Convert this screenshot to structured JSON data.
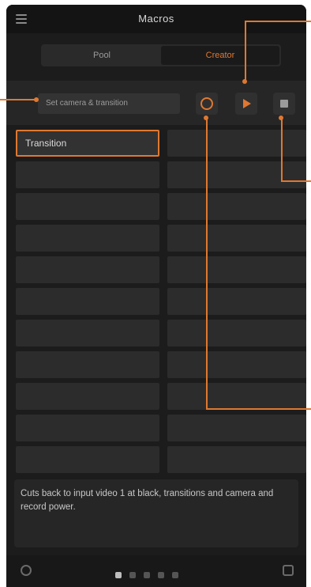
{
  "header": {
    "title": "Macros"
  },
  "segment": {
    "option_a": "Pool",
    "option_b": "Creator"
  },
  "toolbar": {
    "name_placeholder": "Set camera & transition"
  },
  "macros": [
    {
      "label": "Transition",
      "selected": true
    }
  ],
  "description": {
    "text": "Cuts back to input video 1 at black, transitions and camera and record power."
  },
  "colors": {
    "accent": "#e07830",
    "background": "#1c1c1c"
  },
  "icons": {
    "menu": "hamburger-icon",
    "record": "record-icon",
    "play": "play-icon",
    "stop": "stop-icon"
  }
}
